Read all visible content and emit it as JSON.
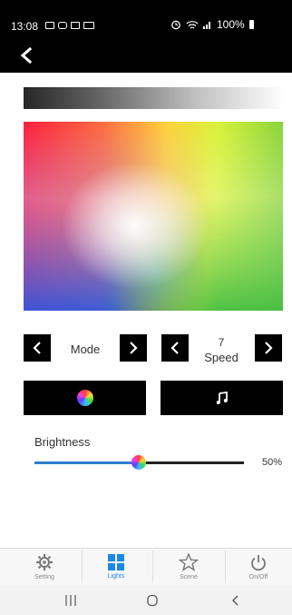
{
  "status_bar": {
    "time": "13:08",
    "battery_text": "100%",
    "icons": [
      "image-icon",
      "message-icon",
      "gallery-icon",
      "screen-icon",
      "alarm-icon",
      "wifi-icon",
      "signal-icon",
      "battery-icon"
    ]
  },
  "header": {
    "back_icon": "chevron-left-icon"
  },
  "controls": {
    "mode_label": "Mode",
    "speed_value": "7",
    "speed_label": "Speed"
  },
  "brightness": {
    "label": "Brightness",
    "value_text": "50%",
    "value": 0.5
  },
  "bottom_nav": {
    "items": [
      {
        "label": "Setting",
        "icon": "gear-icon"
      },
      {
        "label": "Lights",
        "icon": "grid-icon"
      },
      {
        "label": "Scene",
        "icon": "star-icon"
      },
      {
        "label": "On/Off",
        "icon": "power-icon"
      }
    ],
    "active_index": 1
  },
  "colors": {
    "accent": "#2f80cf",
    "bar": "#000000",
    "nav_active": "#1e88e5",
    "nav_inactive": "#888888"
  }
}
